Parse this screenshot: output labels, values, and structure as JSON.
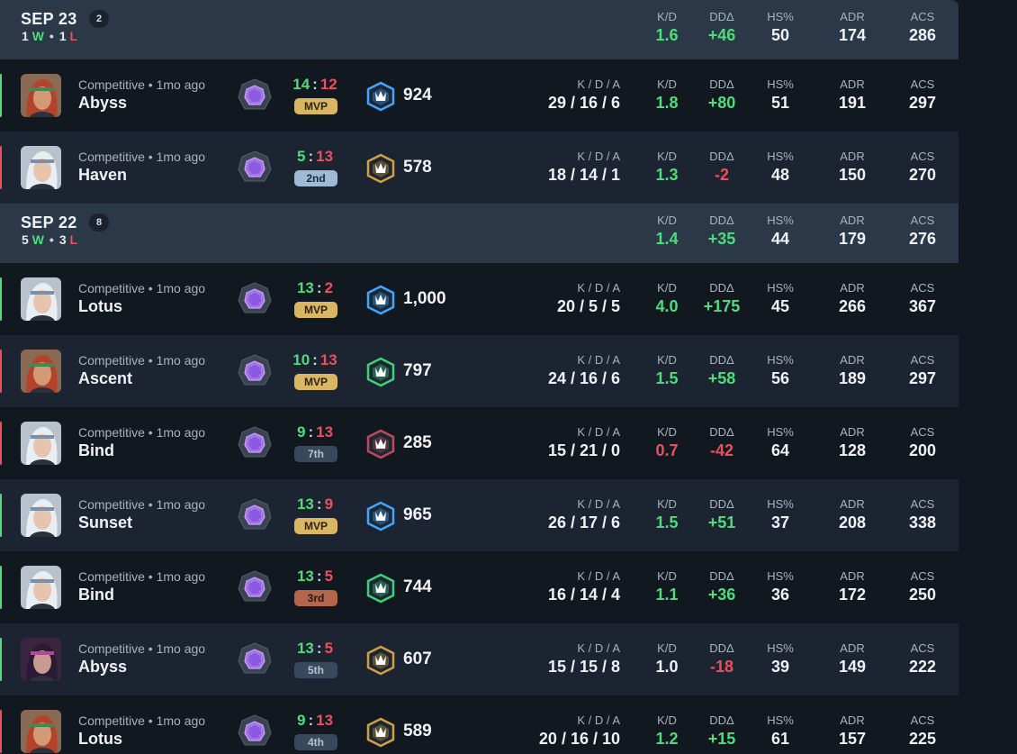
{
  "colors": {
    "win": "#4fdc7c",
    "loss": "#ef4e5c",
    "mvp": "#d8b760",
    "second": "#9fbad6",
    "third": "#b3664a"
  },
  "stat_labels": {
    "kda": "K / D / A",
    "kd": "K/D",
    "dd": "DDΔ",
    "hs": "HS%",
    "adr": "ADR",
    "acs": "ACS"
  },
  "wl_labels": {
    "w": "W",
    "l": "L"
  },
  "days": [
    {
      "date": "SEP 23",
      "count": "2",
      "wins": "1",
      "losses": "1",
      "kd": "1.6",
      "dd": "+46",
      "hs": "50",
      "adr": "174",
      "acs": "286"
    },
    {
      "date": "SEP 22",
      "count": "8",
      "wins": "5",
      "losses": "3",
      "kd": "1.4",
      "dd": "+35",
      "hs": "44",
      "adr": "179",
      "acs": "276"
    }
  ],
  "matches": [
    {
      "result": "win",
      "agent": "agent-portrait-red-hair",
      "mode": "Competitive • 1mo ago",
      "map": "Abyss",
      "score_us": "14",
      "score_them": "12",
      "placement": "MVP",
      "badge": "mvp",
      "perf": "blue",
      "rr": "924",
      "kda": "29 / 16 / 6",
      "kd": "1.8",
      "dd": "+80",
      "hs": "51",
      "adr": "191",
      "acs": "297"
    },
    {
      "result": "loss",
      "agent": "agent-portrait-white-hair",
      "mode": "Competitive • 1mo ago",
      "map": "Haven",
      "score_us": "5",
      "score_them": "13",
      "placement": "2nd",
      "badge": "2nd",
      "perf": "gold",
      "rr": "578",
      "kda": "18 / 14 / 1",
      "kd": "1.3",
      "dd": "-2",
      "hs": "48",
      "adr": "150",
      "acs": "270"
    },
    {
      "result": "win",
      "agent": "agent-portrait-white-hair",
      "mode": "Competitive • 1mo ago",
      "map": "Lotus",
      "score_us": "13",
      "score_them": "2",
      "placement": "MVP",
      "badge": "mvp",
      "perf": "blue",
      "rr": "1,000",
      "kda": "20 / 5 / 5",
      "kd": "4.0",
      "dd": "+175",
      "hs": "45",
      "adr": "266",
      "acs": "367"
    },
    {
      "result": "loss",
      "agent": "agent-portrait-red-hair",
      "mode": "Competitive • 1mo ago",
      "map": "Ascent",
      "score_us": "10",
      "score_them": "13",
      "placement": "MVP",
      "badge": "mvp",
      "perf": "green",
      "rr": "797",
      "kda": "24 / 16 / 6",
      "kd": "1.5",
      "dd": "+58",
      "hs": "56",
      "adr": "189",
      "acs": "297"
    },
    {
      "result": "loss",
      "agent": "agent-portrait-white-hair",
      "mode": "Competitive • 1mo ago",
      "map": "Bind",
      "score_us": "9",
      "score_them": "13",
      "placement": "7th",
      "badge": "grey",
      "perf": "red",
      "rr": "285",
      "kda": "15 / 21 / 0",
      "kd": "0.7",
      "dd": "-42",
      "hs": "64",
      "adr": "128",
      "acs": "200"
    },
    {
      "result": "win",
      "agent": "agent-portrait-white-hair",
      "mode": "Competitive • 1mo ago",
      "map": "Sunset",
      "score_us": "13",
      "score_them": "9",
      "placement": "MVP",
      "badge": "mvp",
      "perf": "blue",
      "rr": "965",
      "kda": "26 / 17 / 6",
      "kd": "1.5",
      "dd": "+51",
      "hs": "37",
      "adr": "208",
      "acs": "338"
    },
    {
      "result": "win",
      "agent": "agent-portrait-white-hair",
      "mode": "Competitive • 1mo ago",
      "map": "Bind",
      "score_us": "13",
      "score_them": "5",
      "placement": "3rd",
      "badge": "3rd",
      "perf": "green",
      "rr": "744",
      "kda": "16 / 14 / 4",
      "kd": "1.1",
      "dd": "+36",
      "hs": "36",
      "adr": "172",
      "acs": "250"
    },
    {
      "result": "win",
      "agent": "agent-portrait-dark-hair",
      "mode": "Competitive • 1mo ago",
      "map": "Abyss",
      "score_us": "13",
      "score_them": "5",
      "placement": "5th",
      "badge": "grey",
      "perf": "gold",
      "rr": "607",
      "kda": "15 / 15 / 8",
      "kd": "1.0",
      "dd": "-18",
      "hs": "39",
      "adr": "149",
      "acs": "222"
    },
    {
      "result": "loss",
      "agent": "agent-portrait-red-hair",
      "mode": "Competitive • 1mo ago",
      "map": "Lotus",
      "score_us": "9",
      "score_them": "13",
      "placement": "4th",
      "badge": "grey",
      "perf": "gold",
      "rr": "589",
      "kda": "20 / 16 / 10",
      "kd": "1.2",
      "dd": "+15",
      "hs": "61",
      "adr": "157",
      "acs": "225"
    }
  ]
}
